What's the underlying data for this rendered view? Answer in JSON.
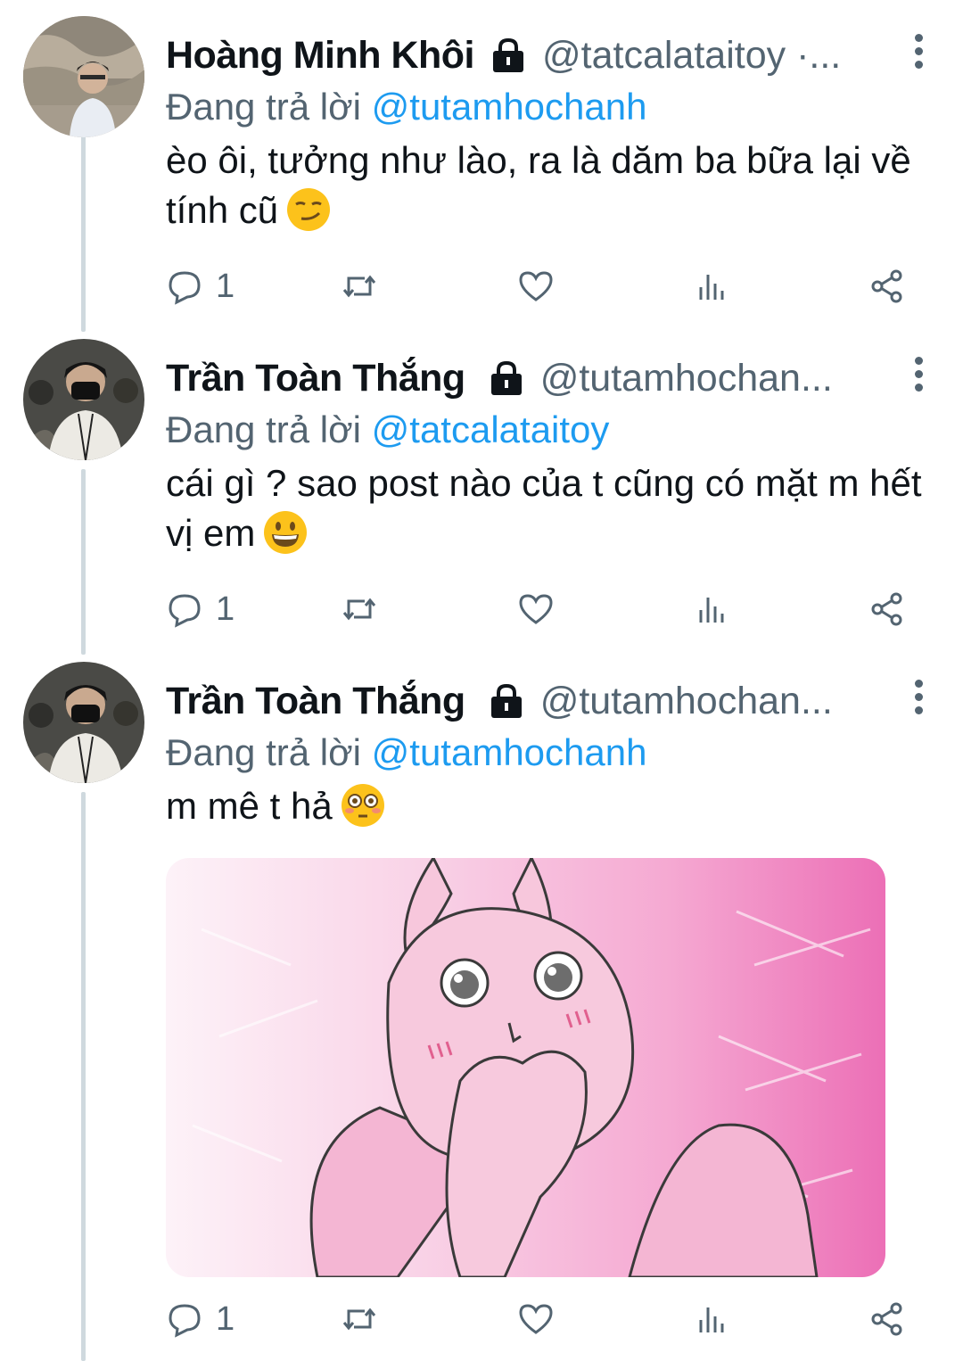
{
  "tweets": [
    {
      "name": "Hoàng Minh Khôi",
      "handle": "@tatcalataitoy ·...",
      "replying_prefix": "Đang trả lời",
      "replying_to": "@tutamhochanh",
      "text": "èo ôi, tưởng như lào, ra là dăm ba bữa lại về tính cũ",
      "emoji": "smirk",
      "reply_count": "1"
    },
    {
      "name": "Trần Toàn Thắng",
      "handle": "@tutamhochan...",
      "replying_prefix": "Đang trả lời",
      "replying_to": "@tatcalataitoy",
      "text": "cái gì ? sao post nào của t cũng có mặt m hết vị em",
      "emoji": "grin",
      "reply_count": "1"
    },
    {
      "name": "Trần Toàn Thắng",
      "handle": "@tutamhochan...",
      "replying_prefix": "Đang trả lời",
      "replying_to": "@tutamhochanh",
      "text": "m mê t hả",
      "emoji": "flushed",
      "reply_count": "1",
      "media": "pink-bunny-blushing-sticker"
    }
  ],
  "icons": {
    "reply": "reply-icon",
    "retweet": "retweet-icon",
    "like": "heart-icon",
    "views": "views-icon",
    "share": "share-icon",
    "lock": "lock-icon",
    "more": "more-vertical-icon"
  },
  "colors": {
    "accent": "#1d9bf0",
    "secondary_text": "#536471",
    "thread_line": "#cfd9de",
    "media_pink": "#f07cbf"
  }
}
